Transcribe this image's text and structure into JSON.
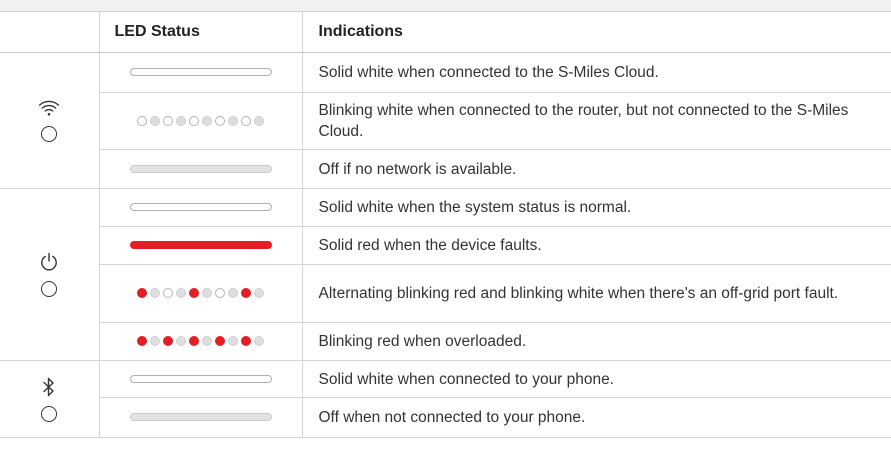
{
  "header": {
    "col1": "",
    "col2": "LED Status",
    "col3": "Indications"
  },
  "groups": [
    {
      "icon": "wifi-icon",
      "rows": [
        {
          "led": "solid-white",
          "text": "Solid white when connected to the S-Miles Cloud."
        },
        {
          "led": "blinking-white",
          "text": "Blinking white when connected to the router, but not connected to the S-Miles Cloud."
        },
        {
          "led": "off",
          "text": "Off if no network is available."
        }
      ]
    },
    {
      "icon": "power-icon",
      "rows": [
        {
          "led": "solid-white",
          "text": "Solid white when the system status is normal."
        },
        {
          "led": "solid-red",
          "text": "Solid red when the device faults."
        },
        {
          "led": "alternating-red-white",
          "text": "Alternating blinking red and blinking white when there's an off-grid port fault."
        },
        {
          "led": "blinking-red",
          "text": "Blinking red when overloaded."
        }
      ]
    },
    {
      "icon": "bluetooth-icon",
      "rows": [
        {
          "led": "solid-white",
          "text": "Solid white when connected to your phone."
        },
        {
          "led": "off",
          "text": "Off when not connected to your phone."
        }
      ]
    }
  ],
  "colors": {
    "red": "#e41e26",
    "white": "#ffffff",
    "off": "#e2e2e2",
    "border": "#d4d4d4"
  }
}
